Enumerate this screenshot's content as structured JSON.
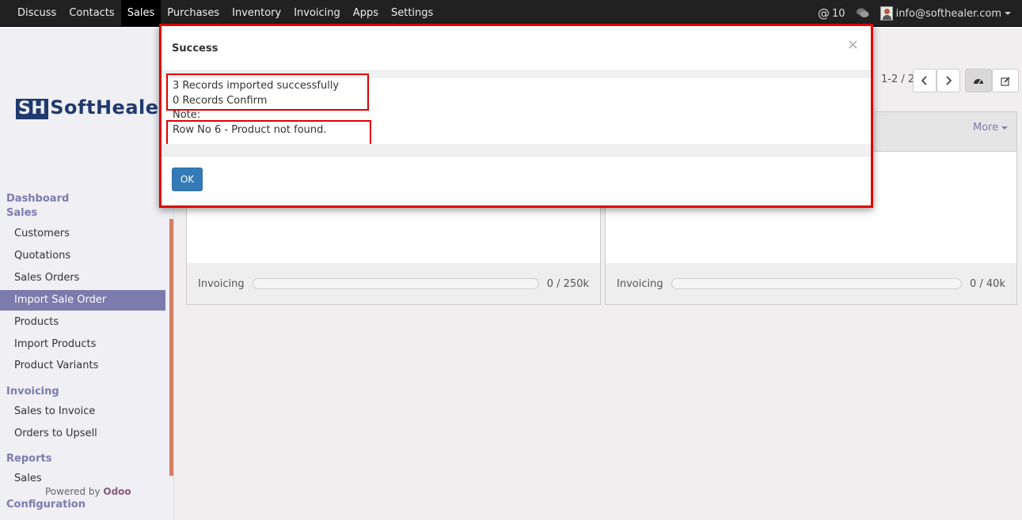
{
  "topbar": {
    "menu": [
      "Discuss",
      "Contacts",
      "Sales",
      "Purchases",
      "Inventory",
      "Invoicing",
      "Apps",
      "Settings"
    ],
    "active_menu": "Sales",
    "mentions_count": "10",
    "user_email": "info@softhealer.com"
  },
  "sidebar": {
    "logo_text": "Soft Healer",
    "logo_mark": "SH",
    "sections": {
      "dashboard": "Dashboard",
      "sales": "Sales",
      "invoicing": "Invoicing",
      "reports": "Reports",
      "configuration": "Configuration"
    },
    "links": {
      "customers": "Customers",
      "quotations": "Quotations",
      "sales_orders": "Sales Orders",
      "import_sale_order": "Import Sale Order",
      "products": "Products",
      "import_products": "Import Products",
      "product_variants": "Product Variants",
      "sales_to_invoice": "Sales to Invoice",
      "orders_to_upsell": "Orders to Upsell",
      "reports_sales": "Sales"
    },
    "powered_by": "Powered by",
    "powered_brand": "Odoo"
  },
  "main": {
    "pager": "1-2 / 2",
    "more_label": "More",
    "cards": [
      {
        "label": "Invoicing",
        "value": "0 / 250k",
        "progress": 0
      },
      {
        "label": "Invoicing",
        "value": "0 / 40k",
        "progress": 0
      }
    ]
  },
  "modal": {
    "title": "Success",
    "close_symbol": "×",
    "line1": "3 Records imported successfully",
    "line2": "0 Records Confirm",
    "note_label": "Note:",
    "note_text": "Row No 6  - Product not found.",
    "ok_label": "OK"
  }
}
